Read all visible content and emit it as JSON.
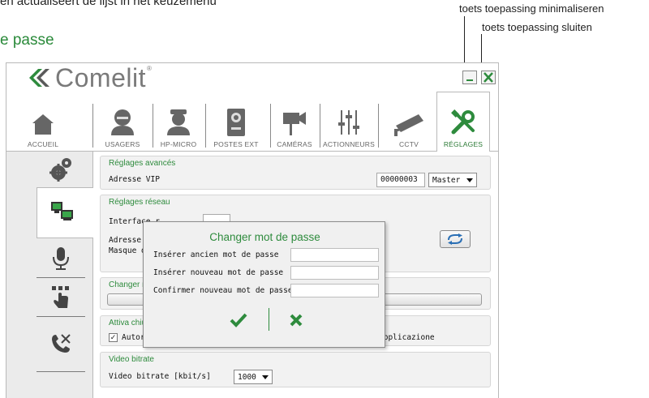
{
  "document": {
    "top_line": "en actualiseert de lijst in het keuzemenu",
    "heading_fragment": "e passe",
    "annotation_minimize": "toets toepassing minimaliseren",
    "annotation_close": "toets toepassing sluiten"
  },
  "app": {
    "logo_text": "Comelit",
    "logo_reg": "®",
    "accent_color": "#2e8b3d",
    "nav": [
      {
        "label": "ACCUEIL",
        "icon": "home-icon"
      },
      {
        "label": "USAGERS",
        "icon": "user-icon"
      },
      {
        "label": "HP-MICRO",
        "icon": "concierge-icon"
      },
      {
        "label": "POSTES EXT",
        "icon": "door-station-icon"
      },
      {
        "label": "CAMÉRAS",
        "icon": "camera-icon"
      },
      {
        "label": "ACTIONNEURS",
        "icon": "sliders-icon"
      },
      {
        "label": "CCTV",
        "icon": "cctv-icon"
      },
      {
        "label": "RÉGLAGES",
        "icon": "tools-icon",
        "active": true
      }
    ],
    "sidebar": [
      {
        "icon": "gears-icon"
      },
      {
        "icon": "network-icon",
        "active": true
      },
      {
        "icon": "microphone-icon"
      },
      {
        "icon": "touch-panel-icon"
      },
      {
        "icon": "phone-settings-icon"
      }
    ]
  },
  "settings": {
    "advanced": {
      "title": "Réglages avancés",
      "vip_label": "Adresse VIP",
      "vip_value": "00000003",
      "role_value": "Master"
    },
    "network": {
      "title": "Réglages réseau",
      "interface_label": "Interface r",
      "ip_label": "Adresse IP",
      "mask_label": "Masque de"
    },
    "password": {
      "title_partial": "Changer m"
    },
    "closing": {
      "title_partial": "Attiva chiu",
      "checkbox_partial": "Autoris",
      "right_text": "applicazione"
    },
    "video": {
      "title": "Video bitrate",
      "label": "Video bitrate [kbit/s]",
      "value": "1000"
    }
  },
  "dialog": {
    "title": "Changer mot de passe",
    "old_label": "Insérer ancien mot de passe",
    "new_label": "Insérer nouveau mot de passe",
    "confirm_label": "Confirmer nouveau mot de passe"
  }
}
